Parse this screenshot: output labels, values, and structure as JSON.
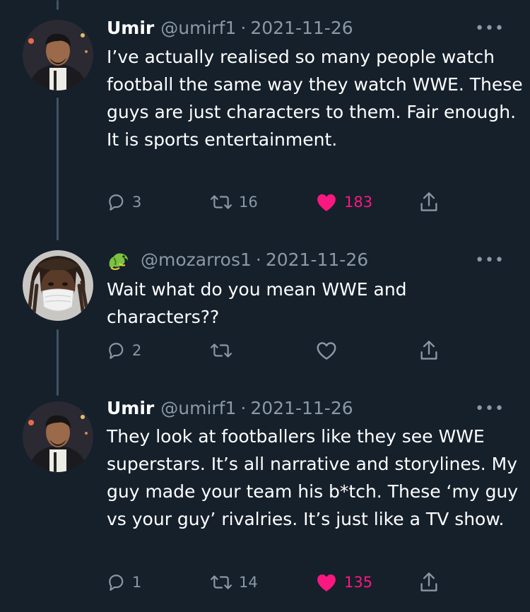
{
  "tweets": [
    {
      "name": "Umir",
      "handle": "@umirf1",
      "date": "2021-11-26",
      "text": "I’ve actually realised so many people watch football the same way they watch WWE. These guys are just characters to them. Fair enough. It is sports entertainment.",
      "replies": "3",
      "retweets": "16",
      "likes": "183",
      "liked": true
    },
    {
      "name": "",
      "handle": "@mozarros1",
      "date": "2021-11-26",
      "text": "Wait what do you mean WWE and characters??",
      "replies": "2",
      "retweets": "",
      "likes": "",
      "liked": false
    },
    {
      "name": "Umir",
      "handle": "@umirf1",
      "date": "2021-11-26",
      "text": "They look at footballers like they see WWE superstars. It’s all narrative and storylines. My guy made your team his b*tch. These ‘my guy vs your guy’ rivalries. It’s just like a TV show.",
      "replies": "1",
      "retweets": "14",
      "likes": "135",
      "liked": true
    }
  ],
  "ui": {
    "more": "•••",
    "separator": "·"
  },
  "colors": {
    "background": "#15202b",
    "muted": "#8b98a5",
    "like": "#f91880",
    "thread": "#3d5466"
  },
  "icons": [
    "reply-icon",
    "retweet-icon",
    "like-icon",
    "share-icon",
    "more-icon",
    "dragon-emoji-icon"
  ]
}
